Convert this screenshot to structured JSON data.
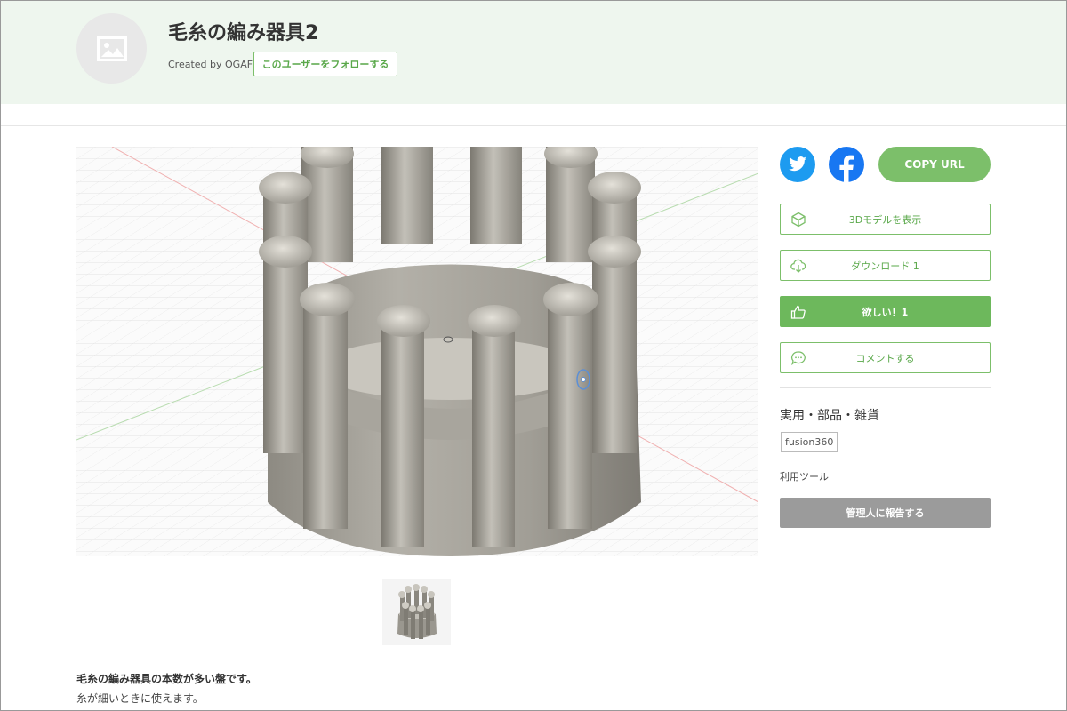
{
  "header": {
    "title": "毛糸の編み器具2",
    "created_by": "Created by OGAF",
    "follow_label": "このユーザーをフォローする"
  },
  "share": {
    "twitter_icon": "twitter-icon",
    "facebook_icon": "facebook-icon",
    "copy_url_label": "COPY URL"
  },
  "actions": {
    "view_3d_label": "3Dモデルを表示",
    "download_label": "ダウンロード 1",
    "want_label": "欲しい！1",
    "comment_label": "コメントする"
  },
  "meta": {
    "category": "実用・部品・雑貨",
    "tag": "fusion360",
    "tools_label": "利用ツール",
    "report_label": "管理人に報告する"
  },
  "description": {
    "line1": "毛糸の編み器具の本数が多い盤です。",
    "line2": "糸が細いときに使えます。"
  },
  "colors": {
    "accent": "#7cbf6a",
    "header_bg": "#eef6ee",
    "twitter": "#1d9bf0",
    "facebook": "#1877f2",
    "report": "#9b9b9b"
  }
}
